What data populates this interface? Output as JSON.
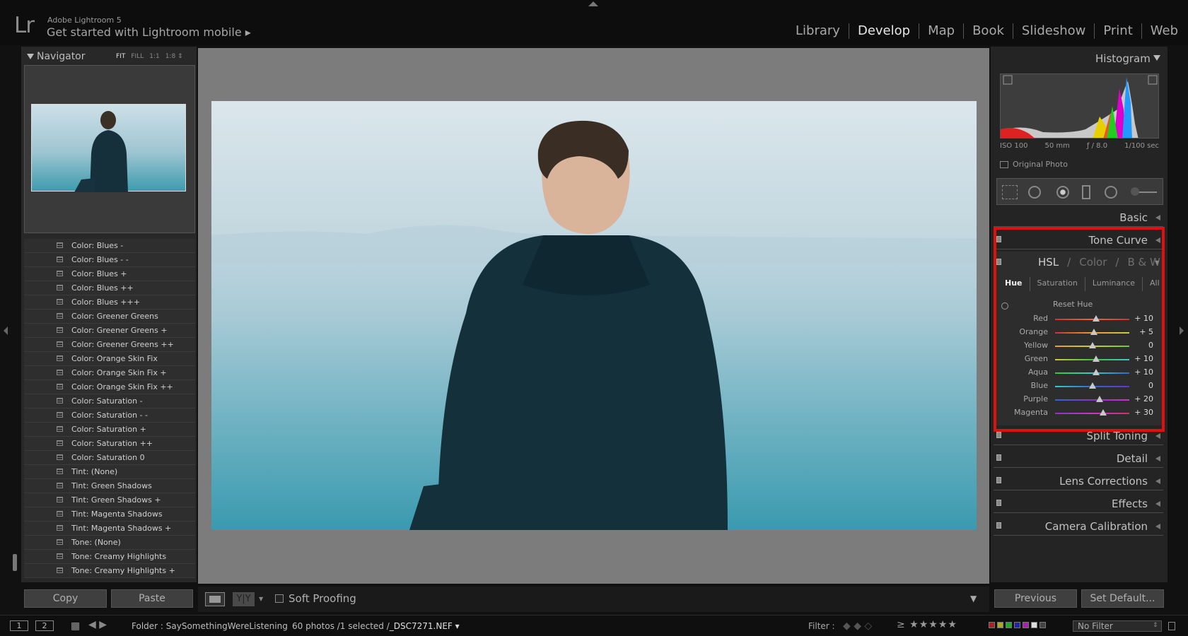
{
  "header": {
    "app_name": "Adobe Lightroom 5",
    "logo": "Lr",
    "mobile_promo": "Get started with Lightroom mobile ▸",
    "modules": [
      "Library",
      "Develop",
      "Map",
      "Book",
      "Slideshow",
      "Print",
      "Web"
    ],
    "active_module": "Develop"
  },
  "navigator": {
    "title": "Navigator",
    "options": [
      "FIT",
      "FILL",
      "1:1",
      "1:8 ⇕"
    ],
    "active_option": "FIT"
  },
  "presets": [
    "Color: Blues -",
    "Color: Blues - -",
    "Color: Blues +",
    "Color: Blues ++",
    "Color: Blues +++",
    "Color: Greener Greens",
    "Color: Greener Greens +",
    "Color: Greener Greens ++",
    "Color: Orange Skin Fix",
    "Color: Orange Skin Fix +",
    "Color: Orange Skin Fix ++",
    "Color: Saturation -",
    "Color: Saturation - -",
    "Color: Saturation +",
    "Color: Saturation ++",
    "Color: Saturation 0",
    "Tint: (None)",
    "Tint: Green Shadows",
    "Tint: Green Shadows +",
    "Tint: Magenta Shadows",
    "Tint: Magenta Shadows +",
    "Tone: (None)",
    "Tone: Creamy Highlights",
    "Tone: Creamy Highlights +"
  ],
  "left_buttons": {
    "copy": "Copy",
    "paste": "Paste"
  },
  "toolbar": {
    "yy": "Y|Y",
    "soft_proofing": "Soft Proofing"
  },
  "histogram": {
    "title": "Histogram",
    "iso": "ISO 100",
    "focal": "50 mm",
    "aperture": "ƒ / 8.0",
    "shutter": "1/100 sec",
    "original_photo": "Original Photo"
  },
  "sections": {
    "basic": "Basic",
    "tone_curve": "Tone Curve",
    "split_toning": "Split Toning",
    "detail": "Detail",
    "lens_corrections": "Lens Corrections",
    "effects": "Effects",
    "camera_calibration": "Camera Calibration"
  },
  "hsl": {
    "tabs": [
      "HSL",
      "/",
      "Color",
      "/",
      "B & W"
    ],
    "active_tab": "HSL",
    "subtabs": [
      "Hue",
      "Saturation",
      "Luminance",
      "All"
    ],
    "active_subtab": "Hue",
    "reset_label": "Reset Hue",
    "rows": [
      {
        "label": "Red",
        "value": "+ 10",
        "num": 10
      },
      {
        "label": "Orange",
        "value": "+ 5",
        "num": 5
      },
      {
        "label": "Yellow",
        "value": "0",
        "num": 0
      },
      {
        "label": "Green",
        "value": "+ 10",
        "num": 10
      },
      {
        "label": "Aqua",
        "value": "+ 10",
        "num": 10
      },
      {
        "label": "Blue",
        "value": "0",
        "num": 0
      },
      {
        "label": "Purple",
        "value": "+ 20",
        "num": 20
      },
      {
        "label": "Magenta",
        "value": "+ 30",
        "num": 30
      }
    ],
    "highlight_color": "#e01010"
  },
  "right_buttons": {
    "previous": "Previous",
    "set_default": "Set Default..."
  },
  "filmstrip": {
    "monitor1": "1",
    "monitor2": "2",
    "folder": "Folder : SaySomethingWereListening",
    "count": "60 photos /1 selected /",
    "filename": "_DSC7271.NEF ▾",
    "filter_label": "Filter :",
    "rating_filter": "≥ ★★★★★",
    "filter_value": "No Filter"
  }
}
